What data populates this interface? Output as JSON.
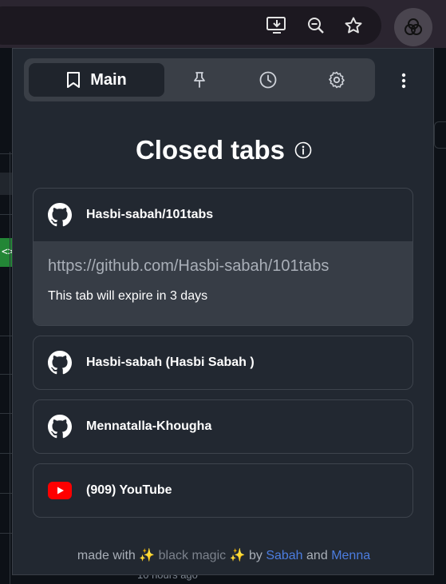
{
  "popup": {
    "nav": {
      "main_label": "Main"
    },
    "heading": "Closed tabs",
    "tabs": [
      {
        "title": "Hasbi-sabah/101tabs",
        "icon": "github-icon",
        "url": "https://github.com/Hasbi-sabah/101tabs",
        "expire": "This tab will expire in 3 days"
      },
      {
        "title": "Hasbi-sabah (Hasbi Sabah )",
        "icon": "github-icon"
      },
      {
        "title": "Mennatalla-Khougha",
        "icon": "github-icon"
      },
      {
        "title": "(909) YouTube",
        "icon": "youtube-icon"
      }
    ],
    "footer": {
      "made_with": "made with",
      "sparkle": "✨",
      "black_magic": "black magic",
      "by": "by",
      "author1": "Sabah",
      "and": "and",
      "author2": "Menna"
    }
  },
  "background": {
    "footer_text": "10 hours ago"
  },
  "colors": {
    "popup_bg": "#222831",
    "accent_link": "#4c7de0",
    "youtube_red": "#ff0000"
  }
}
